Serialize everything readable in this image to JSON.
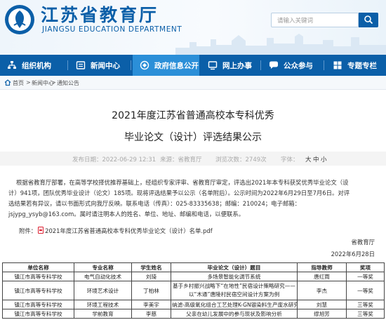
{
  "header": {
    "site_title": "江苏省教育厅",
    "site_subtitle": "JIANGSU EDUCATION DEPARTMENT",
    "search_placeholder": "请输入关键词",
    "brand_color": "#0b5fa8"
  },
  "nav": {
    "items": [
      {
        "label": "组织机构",
        "icon": "org-structure-icon"
      },
      {
        "label": "新闻中心",
        "icon": "news-icon"
      },
      {
        "label": "政府信息公开",
        "icon": "info-disclosure-icon",
        "active": true
      },
      {
        "label": "网上办事",
        "icon": "online-service-icon"
      },
      {
        "label": "公众参与",
        "icon": "public-participation-icon"
      },
      {
        "label": "专题专栏",
        "icon": "special-topic-icon"
      }
    ]
  },
  "breadcrumb": {
    "items": [
      "首页",
      ">",
      "新闻中心",
      ">",
      "通知公告"
    ]
  },
  "article": {
    "title_line1": "2021年度江苏省普通高校本专科优秀",
    "title_line2": "毕业论文（设计）评选结果公示",
    "meta": {
      "date": "发布日期：2022-06-29 12:31",
      "source": "来源：省教育厅",
      "views": "浏览次数：2749次",
      "font_size_label": "字体：",
      "size_options": [
        "大",
        "中",
        "小"
      ]
    },
    "paragraph_lines": [
      "根据省教育厅部署，在高等学校择优推荐基础上，经组织专家评审、省教育厅审定，评选出2021年本专科获奖优秀毕业论文（设",
      "计）941项，团队优秀毕业设计（论文）185项。现将评选结果予以公示（名单附后）。公示时间为2022年6月29日至7月6日。对评",
      "选结果若有异议，请以书面形式向我厅反映。联系电话（传真）：025-83335638；邮编：210024；电子邮箱：",
      "jsjypg_ysyb@163.com。属时请注明本人的姓名、单位、地址、邮编和电话，以便联系。"
    ],
    "attachment_prefix": "附件：",
    "attachment_link": "2021年度江苏省普通高校本专科优秀毕业论文（设计）名单.pdf",
    "signature": "省教育厅",
    "signature_date": "2022年6月28日"
  },
  "table": {
    "headers": [
      "单位名称",
      "专业名称",
      "学生姓名",
      "毕业论文（设计）题目",
      "指导教师",
      "奖项"
    ],
    "rows": [
      [
        "镇江市高等专科学校",
        "电气自动化技术",
        "刘琦",
        "多场景智能化调节系统",
        "唐红雨",
        "一等奖"
      ],
      [
        "镇江市高等专科学校",
        "环境艺术设计",
        "丁柏林",
        "基于乡村振兴战略下“在地性”民宿设计策略研究——以“木通”唐陵村民宿空间设计方案为例",
        "李杰",
        "一等奖"
      ],
      [
        "镇江市高等专科学校",
        "环境工程技术",
        "李美宇",
        "纳滤-高级氧化组合工艺处理K-GN银染料生产废水研究",
        "刘慧",
        "三等奖"
      ],
      [
        "镇江市高等专科学校",
        "学前教育",
        "李慈",
        "父亲在幼儿发展中的参与现状及影响分析",
        "缪旭芳",
        "三等奖"
      ]
    ]
  }
}
